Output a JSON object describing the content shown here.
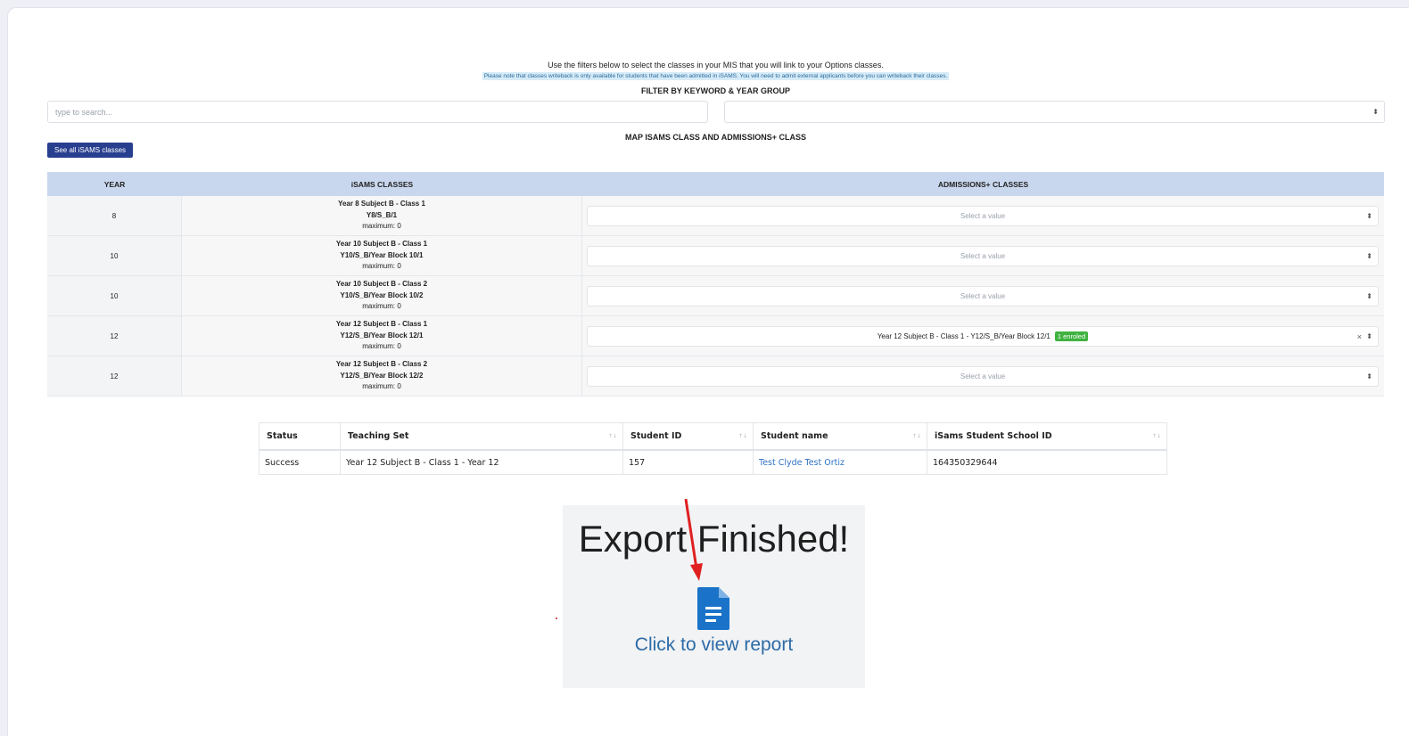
{
  "intro": {
    "line1": "Use the filters below to select the classes in your MIS that you will link to your Options classes.",
    "line2": "Please note that classes writeback is only available for students that have been admitted in iSAMS. You will need to admit external applicants before you can writeback their classes."
  },
  "filters": {
    "heading": "FILTER BY KEYWORD & YEAR GROUP",
    "search_placeholder": "type to search...",
    "year_group_value": ""
  },
  "mapping": {
    "heading": "MAP ISAMS CLASS AND ADMISSIONS+ CLASS",
    "see_all_label": "See all iSAMS classes",
    "columns": [
      "YEAR",
      "iSAMS CLASSES",
      "ADMISSIONS+ CLASSES"
    ],
    "rows": [
      {
        "year": "8",
        "class_name": "Year 8 Subject B - Class 1",
        "class_code": "Y8/S_B/1",
        "maximum": "maximum: 0",
        "select": "Select a value",
        "badge": ""
      },
      {
        "year": "10",
        "class_name": "Year 10 Subject B - Class 1",
        "class_code": "Y10/S_B/Year Block 10/1",
        "maximum": "maximum: 0",
        "select": "Select a value",
        "badge": ""
      },
      {
        "year": "10",
        "class_name": "Year 10 Subject B - Class 2",
        "class_code": "Y10/S_B/Year Block 10/2",
        "maximum": "maximum: 0",
        "select": "Select a value",
        "badge": ""
      },
      {
        "year": "12",
        "class_name": "Year 12 Subject B - Class 1",
        "class_code": "Y12/S_B/Year Block 12/1",
        "maximum": "maximum: 0",
        "select": "Year 12 Subject B - Class 1 - Y12/S_B/Year Block 12/1",
        "badge": "1 enroled"
      },
      {
        "year": "12",
        "class_name": "Year 12 Subject B - Class 2",
        "class_code": "Y12/S_B/Year Block 12/2",
        "maximum": "maximum: 0",
        "select": "Select a value",
        "badge": ""
      }
    ]
  },
  "results": {
    "columns": [
      "Status",
      "Teaching Set",
      "Student ID",
      "Student name",
      "iSams Student School ID"
    ],
    "rows": [
      {
        "status": "Success",
        "teaching_set": "Year 12 Subject B - Class 1 - Year 12",
        "student_id": "157",
        "student_name": "Test Clyde Test Ortiz",
        "school_id": "164350329644"
      }
    ]
  },
  "export": {
    "title": "Export Finished!",
    "link_label": "Click to view report",
    "icon": "document-icon"
  },
  "colors": {
    "header_blue": "#c9d7ee",
    "button_navy": "#283e8f",
    "badge_green": "#3fb33f",
    "link_blue": "#2f72c4",
    "arrow_red": "#e02020"
  }
}
